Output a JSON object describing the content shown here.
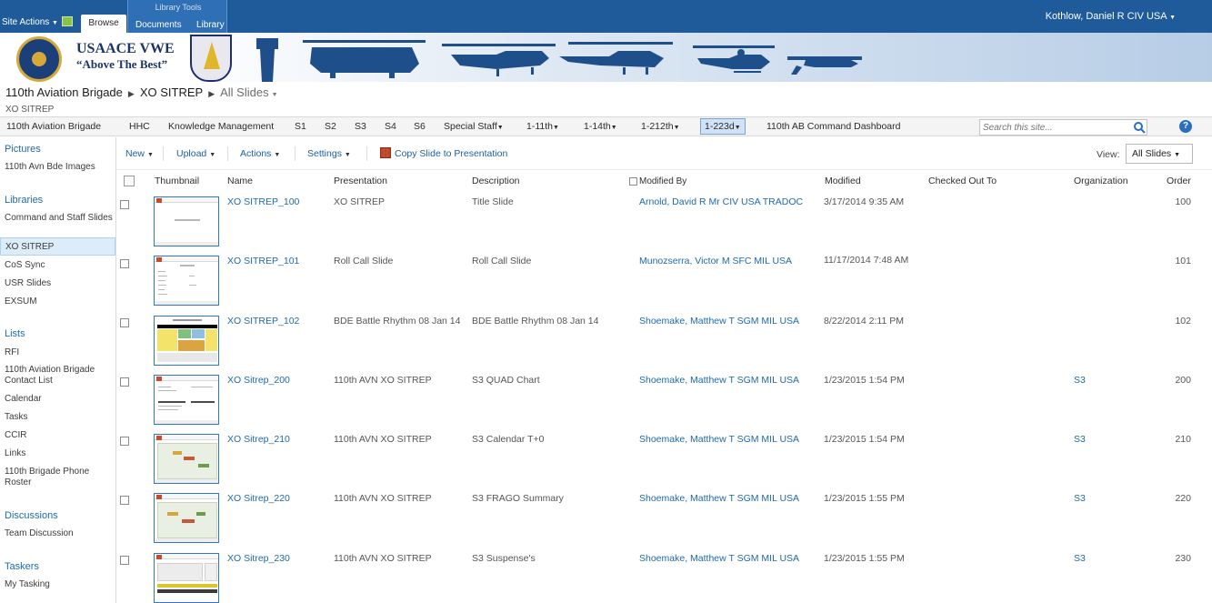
{
  "ribbon": {
    "site_actions": "Site Actions",
    "tab_browse": "Browse",
    "group_label": "Library Tools",
    "tab_documents": "Documents",
    "tab_library": "Library",
    "user": "Kothlow, Daniel R CIV USA"
  },
  "banner": {
    "title": "USAACE VWE",
    "motto": "“Above The Best”"
  },
  "breadcrumb": {
    "items": [
      "110th Aviation Brigade",
      "XO SITREP",
      "All Slides"
    ],
    "sub": "XO SITREP"
  },
  "topnav": {
    "items": [
      "110th Aviation Brigade",
      "HHC",
      "Knowledge Management",
      "S1",
      "S2",
      "S3",
      "S4",
      "S6",
      "Special Staff",
      "1-11th",
      "1-14th",
      "1-212th",
      "1-223d",
      "110th AB Command Dashboard"
    ],
    "selected": "1-223d",
    "search_placeholder": "Search this site..."
  },
  "leftnav": {
    "pictures_heading": "Pictures",
    "pictures": [
      "110th Avn Bde Images"
    ],
    "libraries_heading": "Libraries",
    "libraries": [
      "Command and Staff Slides",
      "XO SITREP",
      "CoS Sync",
      "USR Slides",
      "EXSUM"
    ],
    "lists_heading": "Lists",
    "lists": [
      "RFI",
      "110th Aviation Brigade Contact List",
      "Calendar",
      "Tasks",
      "CCIR",
      "Links",
      "110th Brigade Phone Roster"
    ],
    "discussions_heading": "Discussions",
    "discussions": [
      "Team Discussion"
    ],
    "taskers_heading": "Taskers",
    "taskers": [
      "My Tasking"
    ]
  },
  "toolbar": {
    "new": "New",
    "upload": "Upload",
    "actions": "Actions",
    "settings": "Settings",
    "copy": "Copy Slide to Presentation",
    "view_label": "View:",
    "view_value": "All Slides"
  },
  "columns": [
    "Thumbnail",
    "Name",
    "Presentation",
    "Description",
    "Modified By",
    "Modified",
    "Checked Out To",
    "Organization",
    "Order"
  ],
  "rows": [
    {
      "name": "XO SITREP_100",
      "presentation": "XO SITREP",
      "description": "Title Slide",
      "modified_by": "Arnold, David R Mr CIV USA TRADOC",
      "modified": "3/17/2014 9:35 AM",
      "checked_out": "",
      "organization": "",
      "order": "100"
    },
    {
      "name": "XO SITREP_101",
      "presentation": "Roll Call Slide",
      "description": "Roll Call Slide",
      "modified_by": "Munozserra, Victor M SFC MIL USA",
      "modified": "11/17/2014 7:48 AM",
      "checked_out": "",
      "organization": "",
      "order": "101"
    },
    {
      "name": "XO SITREP_102",
      "presentation": "BDE Battle Rhythm 08 Jan 14",
      "description": "BDE Battle Rhythm 08 Jan 14",
      "modified_by": "Shoemake, Matthew T SGM MIL USA",
      "modified": "8/22/2014 2:11 PM",
      "checked_out": "",
      "organization": "",
      "order": "102"
    },
    {
      "name": "XO Sitrep_200",
      "presentation": "110th AVN XO SITREP",
      "description": "S3 QUAD Chart",
      "modified_by": "Shoemake, Matthew T SGM MIL USA",
      "modified": "1/23/2015 1:54 PM",
      "checked_out": "",
      "organization": "S3",
      "order": "200"
    },
    {
      "name": "XO Sitrep_210",
      "presentation": "110th AVN XO SITREP",
      "description": "S3 Calendar T+0",
      "modified_by": "Shoemake, Matthew T SGM MIL USA",
      "modified": "1/23/2015 1:54 PM",
      "checked_out": "",
      "organization": "S3",
      "order": "210"
    },
    {
      "name": "XO Sitrep_220",
      "presentation": "110th AVN XO SITREP",
      "description": "S3 FRAGO Summary",
      "modified_by": "Shoemake, Matthew T SGM MIL USA",
      "modified": "1/23/2015 1:55 PM",
      "checked_out": "",
      "organization": "S3",
      "order": "220"
    },
    {
      "name": "XO Sitrep_230",
      "presentation": "110th AVN XO SITREP",
      "description": "S3 Suspense's",
      "modified_by": "Shoemake, Matthew T SGM MIL USA",
      "modified": "1/23/2015 1:55 PM",
      "checked_out": "",
      "organization": "S3",
      "order": "230"
    }
  ],
  "colors": {
    "ribbon": "#1f5a9a",
    "link": "#1f6aa8",
    "selected_nav": "#cfe2f6",
    "silhouette": "#1f4f8a"
  }
}
